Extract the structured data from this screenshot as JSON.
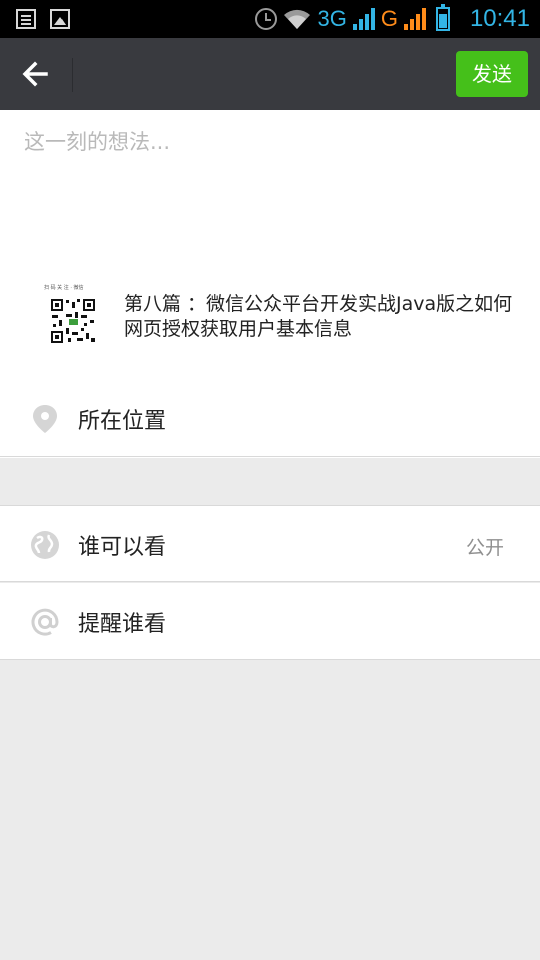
{
  "status_bar": {
    "left_icons": [
      "notepad-icon",
      "gallery-icon"
    ],
    "right_icons": [
      "alarm-icon",
      "wifi-icon",
      "signal-3g-icon",
      "signal-g-icon",
      "battery-icon"
    ],
    "network_1": "3G",
    "network_2": "G",
    "time": "10:41",
    "accent_color": "#33b5e5"
  },
  "action_bar": {
    "back_icon": "back-arrow-icon",
    "send_label": "发送",
    "send_color": "#45c01a"
  },
  "compose": {
    "placeholder": "这一刻的想法..."
  },
  "shared_link": {
    "title": "第八篇 ：微信公众平台开发实战Java版之如何网页授权获取用户基本信息",
    "thumbnail_icon": "qr-code-thumbnail",
    "thumbnail_caption": "扫 码 关 注 · 微信"
  },
  "options": {
    "location_label": "所在位置",
    "location_icon": "location-pin-icon",
    "visibility_label": "谁可以看",
    "visibility_value": "公开",
    "visibility_icon": "globe-icon",
    "remind_label": "提醒谁看",
    "remind_icon": "at-sign-icon"
  }
}
